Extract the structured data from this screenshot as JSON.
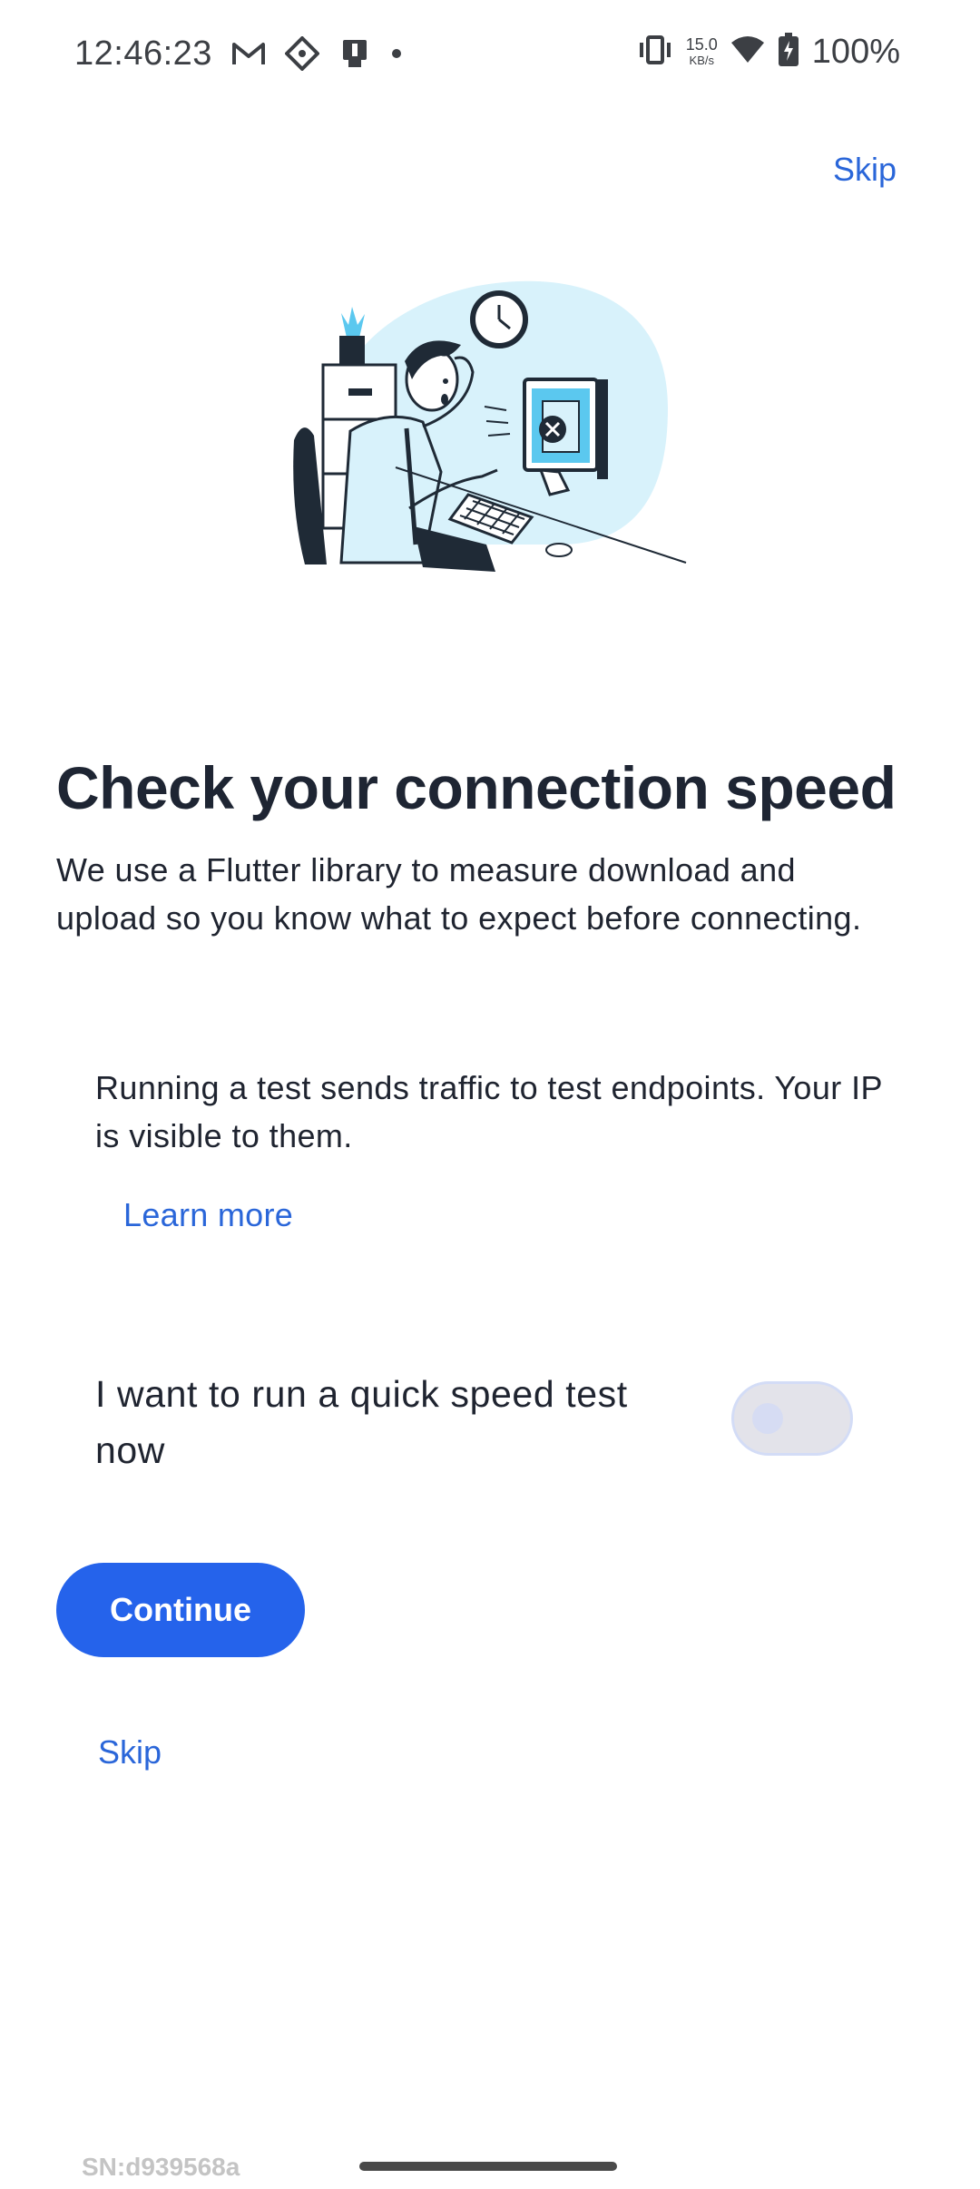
{
  "status_bar": {
    "time": "12:46:23",
    "left_icons": [
      "gmail-icon",
      "app-diamond-icon",
      "device-icon",
      "dot-icon"
    ],
    "network_speed_value": "15.0",
    "network_speed_unit": "KB/s",
    "battery_percent": "100%",
    "right_icons": [
      "vibrate-icon",
      "wifi-icon",
      "battery-charging-icon"
    ]
  },
  "header": {
    "skip_label": "Skip"
  },
  "content": {
    "title": "Check your connection speed",
    "description": "We use a Flutter library to measure download and upload so you know what to expect before connecting.",
    "note": "Running a test sends traffic to test endpoints. Your IP is visible to them.",
    "learn_more_label": "Learn more",
    "toggle_label": "I want to run a quick speed test now",
    "toggle_on": false
  },
  "actions": {
    "continue_label": "Continue",
    "skip_label": "Skip"
  },
  "footer": {
    "serial": "SN:d939568a"
  },
  "colors": {
    "accent": "#2563eb",
    "link": "#2a66d9",
    "title": "#1e2533",
    "illustration_blue": "#d8f2fb",
    "illustration_accent": "#5bc8ef"
  }
}
